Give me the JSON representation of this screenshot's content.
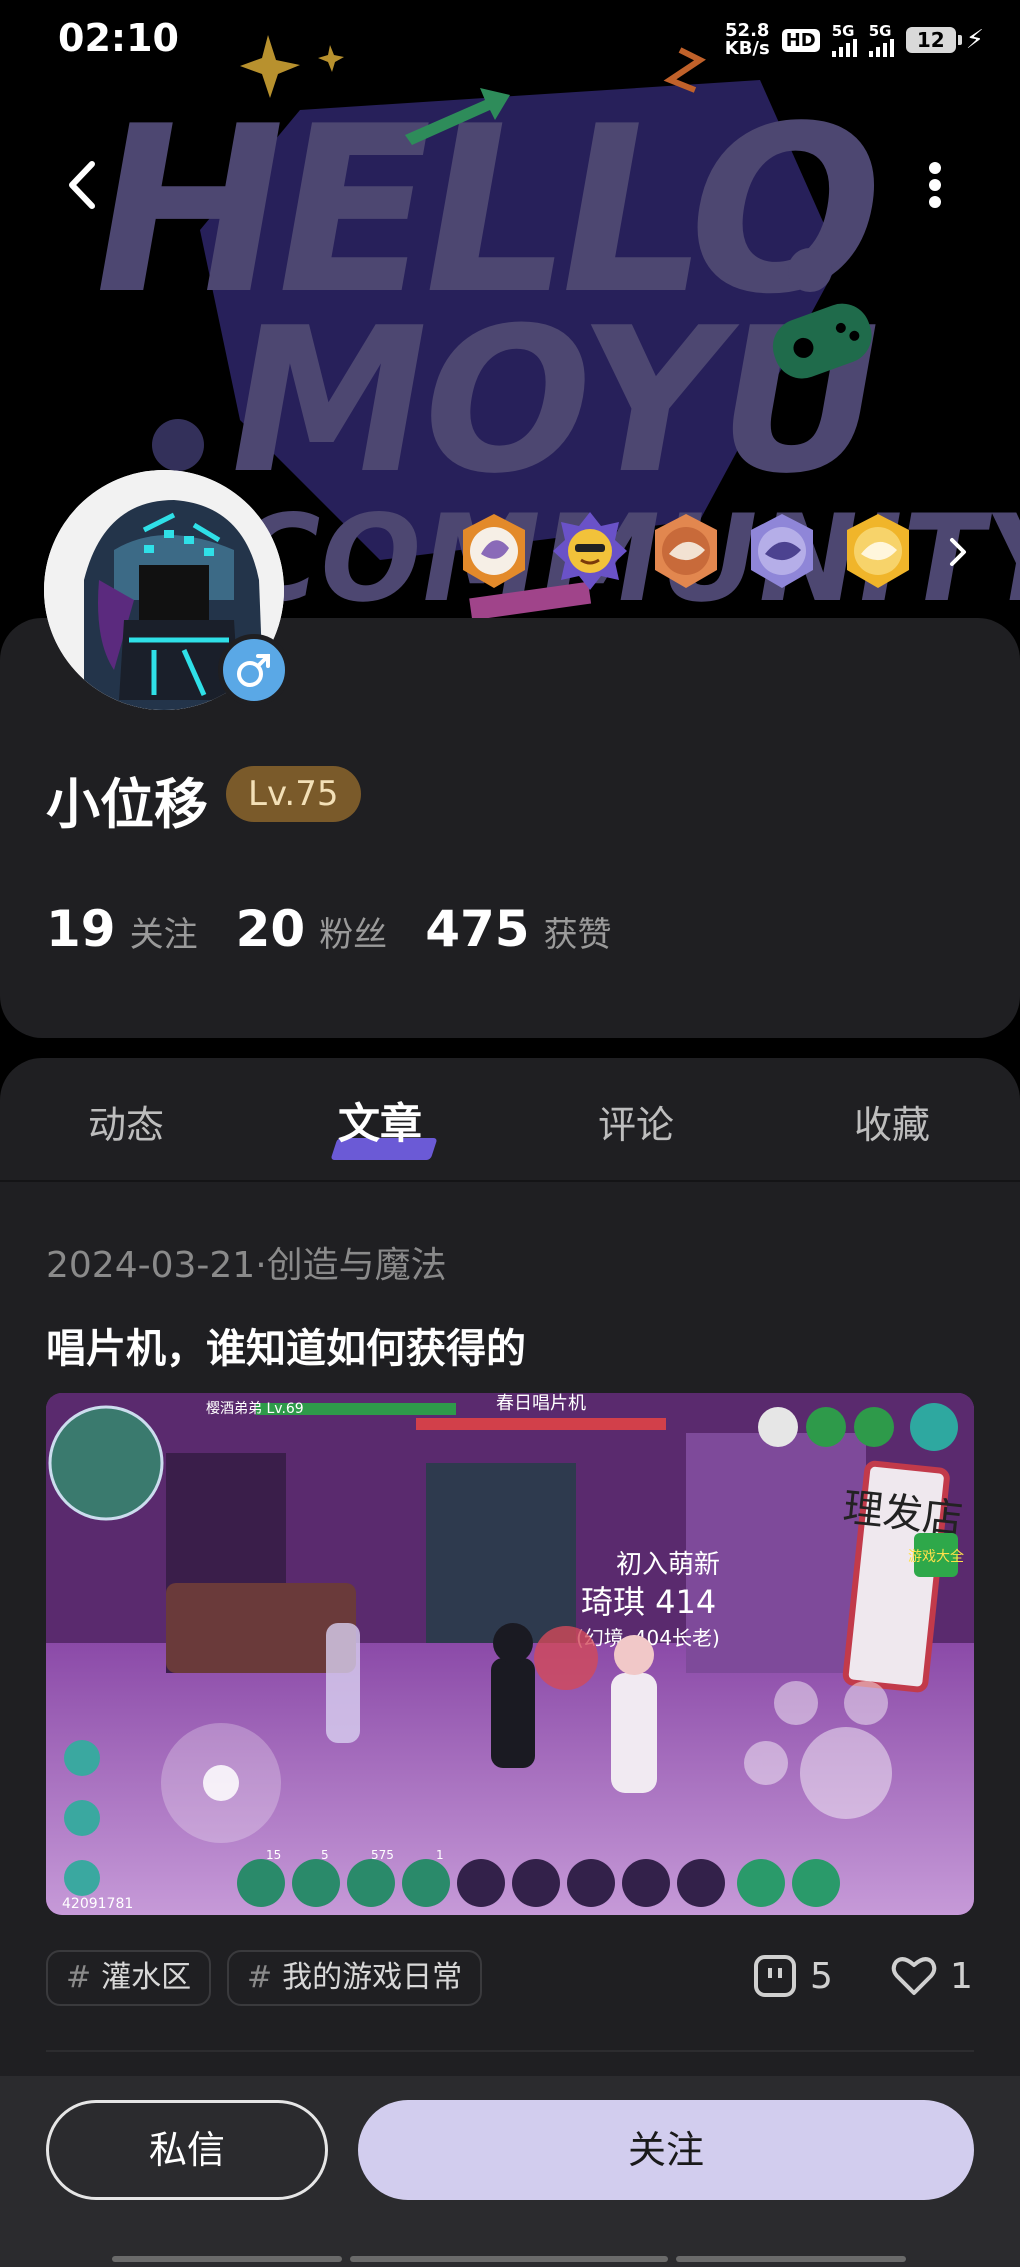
{
  "status_bar": {
    "time": "02:10",
    "net_speed_value": "52.8",
    "net_speed_unit": "KB/s",
    "hd_label": "HD",
    "sim1": "1",
    "sim2": "2",
    "signal_1_label": "5G",
    "signal_2_label": "5G",
    "battery": "12"
  },
  "banner": {
    "brand_lettering": "HELLO. MOYU COMMUNITY"
  },
  "profile": {
    "username": "小位移",
    "level": "Lv.75",
    "stats": [
      {
        "value": "19",
        "label": "关注"
      },
      {
        "value": "20",
        "label": "粉丝"
      },
      {
        "value": "475",
        "label": "获赞"
      }
    ],
    "gender_icon": "male-icon"
  },
  "tabs": [
    {
      "label": "动态",
      "active": false
    },
    {
      "label": "文章",
      "active": true
    },
    {
      "label": "评论",
      "active": false
    },
    {
      "label": "收藏",
      "active": false
    }
  ],
  "post": {
    "date": "2024-03-21",
    "separator": "·",
    "category": "创造与魔法",
    "title": "唱片机，谁知道如何获得的",
    "tags": [
      "灌水区",
      "我的游戏日常"
    ],
    "comments": "5",
    "likes": "1",
    "screenshot_text": {
      "shop_sign": "理发店",
      "player_name": "琦琪 414",
      "player_sub": "初入萌新",
      "player_world": "(幻境_404长老)",
      "header_center": "春日唱片机",
      "game_badge": "游戏大全",
      "level_label": "樱酒弟弟 Lv.69",
      "uid": "42091781",
      "hotbar_counts": [
        "15",
        "5",
        "575",
        "1"
      ]
    }
  },
  "bottom": {
    "message_label": "私信",
    "follow_label": "关注"
  },
  "colors": {
    "card_bg": "#1f1f22",
    "accent_purple": "#6b5ad6",
    "follow_bg": "#d2cdee",
    "level_bg": "#7a5a2a"
  }
}
